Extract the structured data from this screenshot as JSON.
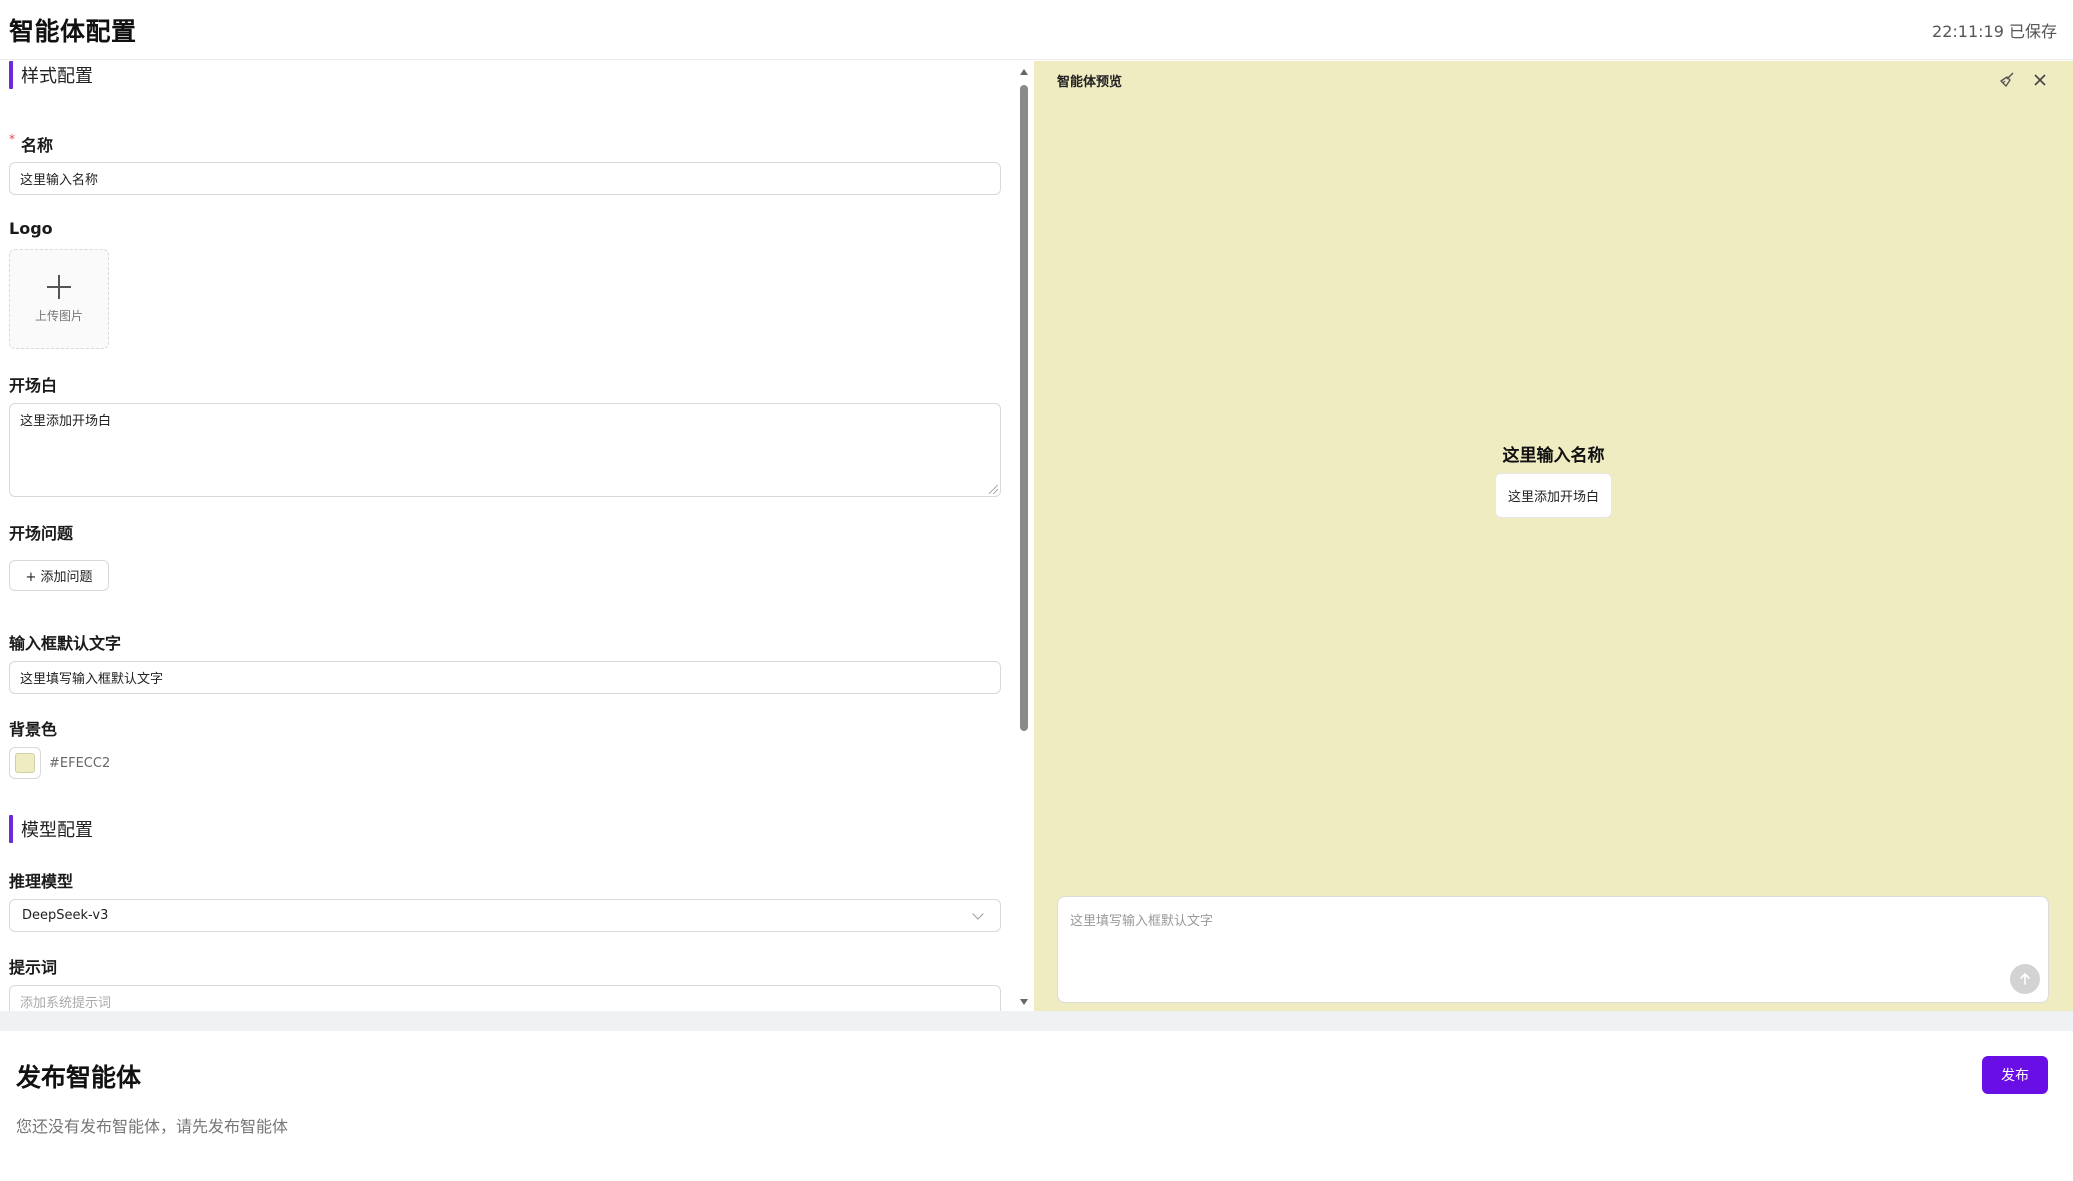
{
  "header": {
    "title": "智能体配置",
    "save_status": "22:11:19 已保存"
  },
  "style_section": {
    "title": "样式配置",
    "name": {
      "label": "名称",
      "required": "*",
      "value": "这里输入名称"
    },
    "logo": {
      "label": "Logo",
      "upload_text": "上传图片"
    },
    "opening": {
      "label": "开场白",
      "value": "这里添加开场白"
    },
    "questions": {
      "label": "开场问题",
      "add_button": "+ 添加问题"
    },
    "placeholder_text": {
      "label": "输入框默认文字",
      "value": "这里填写输入框默认文字"
    },
    "background": {
      "label": "背景色",
      "value": "#EFECC2"
    }
  },
  "model_section": {
    "title": "模型配置",
    "model": {
      "label": "推理模型",
      "value": "DeepSeek-v3"
    },
    "prompt": {
      "label": "提示词",
      "placeholder": "添加系统提示词"
    }
  },
  "preview": {
    "title": "智能体预览",
    "agent_name": "这里输入名称",
    "opening": "这里添加开场白",
    "input_placeholder": "这里填写输入框默认文字",
    "background_color": "#EFECC2"
  },
  "publish": {
    "title": "发布智能体",
    "description": "您还没有发布智能体，请先发布智能体",
    "button_label": "发布"
  },
  "colors": {
    "accent": "#6a0ee6",
    "section_bar": "#6b2bd9",
    "preview_bg": "#EFECC2"
  }
}
